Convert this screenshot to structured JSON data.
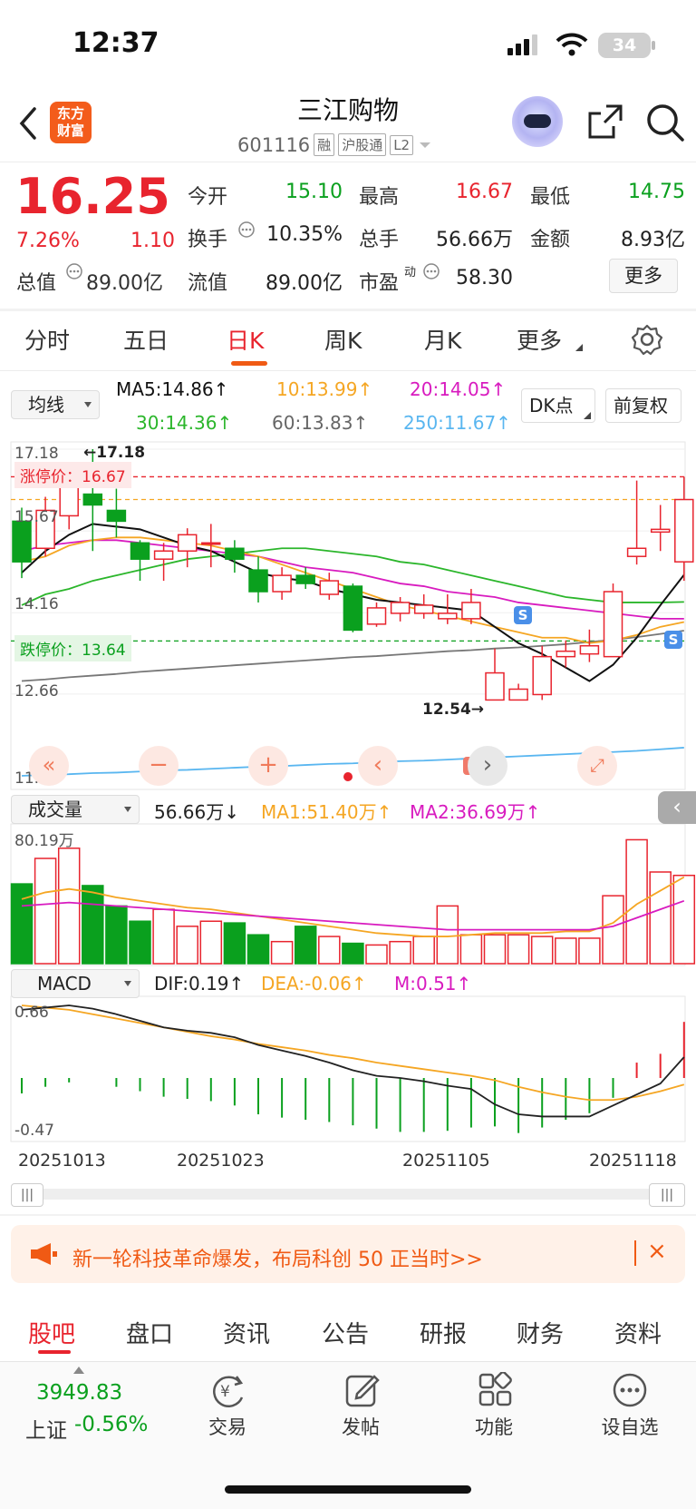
{
  "status": {
    "time": "12:37",
    "battery": "34"
  },
  "header": {
    "title": "三江购物",
    "code": "601116",
    "tags": [
      "融",
      "沪股通",
      "L2"
    ],
    "logo_line1": "东方",
    "logo_line2": "财富"
  },
  "quote": {
    "price": "16.25",
    "change_pct": "7.26%",
    "change": "1.10",
    "open_label": "今开",
    "open": "15.10",
    "high_label": "最高",
    "high": "16.67",
    "low_label": "最低",
    "low": "14.75",
    "turnover_label": "换手",
    "turnover": "10.35%",
    "volume_label": "总手",
    "volume": "56.66万",
    "amount_label": "金额",
    "amount": "8.93亿",
    "mcap_label": "总值",
    "mcap": "89.00亿",
    "float_label": "流值",
    "float": "89.00亿",
    "pe_label": "市盈",
    "pe_sup": "动",
    "pe": "58.30",
    "more": "更多"
  },
  "tabs": [
    "分时",
    "五日",
    "日K",
    "周K",
    "月K",
    "更多"
  ],
  "indicator_bar": {
    "select": "均线",
    "ma5": "MA5:14.86↑",
    "ma10": "10:13.99↑",
    "ma20": "20:14.05↑",
    "ma30": "30:14.36↑",
    "ma60": "60:13.83↑",
    "ma250": "250:11.67↑",
    "dk": "DK点",
    "fq": "前复权"
  },
  "colors": {
    "up": "#e8242e",
    "down": "#0aa01e",
    "ma5": "#111111",
    "ma10": "#f5a623",
    "ma20": "#d81bbf",
    "ma30": "#2bb62b",
    "ma60": "#777777",
    "ma250": "#59b6f0",
    "accent": "#f05a14"
  },
  "kline": {
    "axis_top": "17.18",
    "axis_2": "15.67",
    "axis_3": "14.16",
    "axis_4": "12.66",
    "axis_bottom": "11.15",
    "max_mark": "←17.18",
    "min_mark": "12.54→",
    "limit_up": "涨停价：16.67",
    "limit_down": "跌停价：13.64"
  },
  "volume": {
    "select": "成交量",
    "value": "56.66万↓",
    "ma1": "MA1:51.40万↑",
    "ma2": "MA2:36.69万↑",
    "axis_top": "80.19万"
  },
  "macd": {
    "select": "MACD",
    "dif": "DIF:0.19↑",
    "dea": "DEA:-0.06↑",
    "m": "M:0.51↑",
    "axis_top": "0.66",
    "axis_bottom": "-0.47"
  },
  "dates": [
    "20251013",
    "20251023",
    "20251105",
    "20251118"
  ],
  "chart_data": {
    "type": "candlestick",
    "candles": [
      {
        "o": 15.85,
        "c": 15.1,
        "h": 16.1,
        "l": 14.8
      },
      {
        "o": 15.35,
        "c": 16.05,
        "h": 16.3,
        "l": 15.2
      },
      {
        "o": 15.95,
        "c": 16.65,
        "h": 16.85,
        "l": 15.7
      },
      {
        "o": 16.35,
        "c": 16.15,
        "h": 17.18,
        "l": 15.3
      },
      {
        "o": 16.05,
        "c": 15.85,
        "h": 16.45,
        "l": 15.55
      },
      {
        "o": 15.45,
        "c": 15.15,
        "h": 15.5,
        "l": 14.75
      },
      {
        "o": 15.15,
        "c": 15.3,
        "h": 15.45,
        "l": 14.75
      },
      {
        "o": 15.3,
        "c": 15.6,
        "h": 15.72,
        "l": 15.0
      },
      {
        "o": 15.45,
        "c": 15.45,
        "h": 15.8,
        "l": 15.0
      },
      {
        "o": 15.35,
        "c": 15.15,
        "h": 15.5,
        "l": 14.9
      },
      {
        "o": 14.95,
        "c": 14.55,
        "h": 15.2,
        "l": 14.35
      },
      {
        "o": 14.55,
        "c": 14.85,
        "h": 15.0,
        "l": 14.4
      },
      {
        "o": 14.85,
        "c": 14.7,
        "h": 15.0,
        "l": 14.6
      },
      {
        "o": 14.5,
        "c": 14.75,
        "h": 14.9,
        "l": 14.4
      },
      {
        "o": 14.65,
        "c": 13.84,
        "h": 14.7,
        "l": 13.8
      },
      {
        "o": 13.95,
        "c": 14.25,
        "h": 14.35,
        "l": 13.9
      },
      {
        "o": 14.15,
        "c": 14.35,
        "h": 14.45,
        "l": 14.0
      },
      {
        "o": 14.15,
        "c": 14.3,
        "h": 14.5,
        "l": 14.05
      },
      {
        "o": 14.05,
        "c": 14.15,
        "h": 14.5,
        "l": 13.95
      },
      {
        "o": 14.05,
        "c": 14.35,
        "h": 14.6,
        "l": 13.95
      },
      {
        "o": 12.55,
        "c": 13.05,
        "h": 13.5,
        "l": 12.54
      },
      {
        "o": 12.55,
        "c": 12.75,
        "h": 12.85,
        "l": 12.55
      },
      {
        "o": 12.65,
        "c": 13.35,
        "h": 13.55,
        "l": 12.55
      },
      {
        "o": 13.35,
        "c": 13.45,
        "h": 13.65,
        "l": 13.15
      },
      {
        "o": 13.4,
        "c": 13.55,
        "h": 13.85,
        "l": 13.25
      },
      {
        "o": 13.35,
        "c": 14.55,
        "h": 14.7,
        "l": 13.35
      },
      {
        "o": 15.2,
        "c": 15.35,
        "h": 16.6,
        "l": 15.05
      },
      {
        "o": 15.65,
        "c": 15.7,
        "h": 16.15,
        "l": 15.3
      },
      {
        "o": 15.1,
        "c": 16.25,
        "h": 16.67,
        "l": 14.75
      }
    ],
    "ma5": [
      14.9,
      15.3,
      15.6,
      15.8,
      15.75,
      15.7,
      15.55,
      15.4,
      15.3,
      15.1,
      14.9,
      14.8,
      14.75,
      14.6,
      14.5,
      14.4,
      14.35,
      14.3,
      14.25,
      14.2,
      13.9,
      13.6,
      13.4,
      13.15,
      12.9,
      13.2,
      13.7,
      14.3,
      14.86
    ],
    "ma10": [
      15.1,
      15.2,
      15.4,
      15.5,
      15.55,
      15.55,
      15.5,
      15.45,
      15.4,
      15.3,
      15.2,
      15.05,
      14.9,
      14.75,
      14.6,
      14.45,
      14.3,
      14.2,
      14.1,
      14.0,
      13.9,
      13.8,
      13.7,
      13.7,
      13.6,
      13.65,
      13.75,
      13.9,
      13.99
    ],
    "ma20": [
      15.3,
      15.4,
      15.45,
      15.5,
      15.5,
      15.45,
      15.4,
      15.35,
      15.3,
      15.25,
      15.2,
      15.1,
      15.0,
      14.95,
      14.9,
      14.8,
      14.7,
      14.65,
      14.55,
      14.5,
      14.45,
      14.35,
      14.3,
      14.25,
      14.2,
      14.15,
      14.1,
      14.05,
      14.05
    ],
    "ma30": [
      14.3,
      14.5,
      14.6,
      14.75,
      14.85,
      14.95,
      15.05,
      15.15,
      15.2,
      15.25,
      15.3,
      15.35,
      15.35,
      15.3,
      15.25,
      15.2,
      15.1,
      15.05,
      14.95,
      14.85,
      14.75,
      14.65,
      14.55,
      14.45,
      14.4,
      14.35,
      14.35,
      14.35,
      14.36
    ],
    "ma60": [
      12.9,
      12.93,
      12.97,
      13.0,
      13.03,
      13.07,
      13.1,
      13.13,
      13.16,
      13.19,
      13.22,
      13.25,
      13.28,
      13.31,
      13.34,
      13.36,
      13.39,
      13.42,
      13.45,
      13.47,
      13.5,
      13.52,
      13.55,
      13.58,
      13.62,
      13.66,
      13.71,
      13.77,
      13.83
    ],
    "ma250": [
      11.15,
      11.17,
      11.18,
      11.2,
      11.21,
      11.23,
      11.25,
      11.26,
      11.28,
      11.3,
      11.32,
      11.33,
      11.35,
      11.37,
      11.38,
      11.4,
      11.42,
      11.43,
      11.45,
      11.47,
      11.49,
      11.51,
      11.53,
      11.55,
      11.57,
      11.59,
      11.61,
      11.64,
      11.67
    ],
    "ylim": [
      11.15,
      17.18
    ],
    "volumes": [
      47,
      62,
      68,
      46,
      34,
      25,
      32,
      22,
      25,
      24,
      17,
      13,
      22,
      16,
      12,
      11,
      13,
      16,
      34,
      17,
      17,
      17,
      16,
      15,
      15,
      40,
      73,
      54,
      52
    ],
    "vol_ylim": [
      0,
      80.19
    ],
    "vol_ma1": [
      38,
      42,
      44,
      42,
      39,
      37,
      35,
      33,
      32,
      30,
      28,
      26,
      24,
      22,
      20,
      18,
      17,
      16,
      16,
      17,
      18,
      18,
      18,
      19,
      19,
      24,
      35,
      43,
      51
    ],
    "vol_ma2": [
      34,
      35,
      36,
      35,
      34,
      33,
      32,
      31,
      30,
      29,
      28,
      27,
      26,
      25,
      24,
      23,
      22,
      21,
      20,
      20,
      20,
      20,
      20,
      20,
      20,
      22,
      27,
      32,
      37
    ],
    "macd_dif": [
      0.62,
      0.64,
      0.66,
      0.63,
      0.58,
      0.52,
      0.46,
      0.43,
      0.41,
      0.37,
      0.3,
      0.25,
      0.2,
      0.14,
      0.07,
      0.02,
      0.0,
      -0.03,
      -0.07,
      -0.1,
      -0.24,
      -0.33,
      -0.35,
      -0.35,
      -0.35,
      -0.25,
      -0.15,
      -0.05,
      0.19
    ],
    "macd_dea": [
      0.66,
      0.64,
      0.62,
      0.58,
      0.54,
      0.5,
      0.46,
      0.42,
      0.38,
      0.35,
      0.31,
      0.28,
      0.25,
      0.21,
      0.18,
      0.14,
      0.11,
      0.08,
      0.05,
      0.02,
      -0.02,
      -0.08,
      -0.13,
      -0.17,
      -0.2,
      -0.2,
      -0.17,
      -0.12,
      -0.06
    ],
    "macd_hist": [
      -0.14,
      -0.08,
      -0.04,
      0.0,
      -0.08,
      -0.12,
      -0.17,
      -0.19,
      -0.21,
      -0.25,
      -0.33,
      -0.36,
      -0.38,
      -0.4,
      -0.43,
      -0.46,
      -0.49,
      -0.49,
      -0.48,
      -0.45,
      -0.44,
      -0.5,
      -0.45,
      -0.38,
      -0.32,
      -0.18,
      0.14,
      0.22,
      0.51
    ],
    "macd_ylim": [
      -0.47,
      0.66
    ]
  },
  "banner": {
    "text": "新一轮科技革命爆发，布局科创 50 正当时>>"
  },
  "bottom_tabs": [
    "股吧",
    "盘口",
    "资讯",
    "公告",
    "研报",
    "财务",
    "资料"
  ],
  "bottom_nav": {
    "index_value": "3949.83",
    "index_name": "上证",
    "index_change": "-0.56%",
    "trade": "交易",
    "post": "发帖",
    "func": "功能",
    "watch": "设自选"
  }
}
